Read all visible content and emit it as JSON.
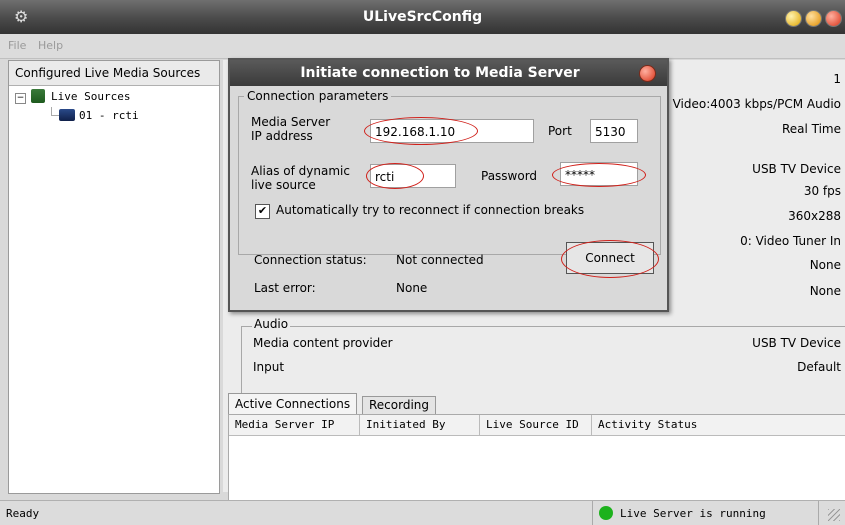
{
  "window": {
    "title": "ULiveSrcConfig"
  },
  "menu": [
    {
      "label": "File"
    },
    {
      "label": "Help"
    }
  ],
  "left_panel": {
    "header": "Configured Live Media Sources",
    "tree": {
      "root": "Live Sources",
      "child": "01 - rcti"
    }
  },
  "right_panel": {
    "values": [
      "1",
      "Video:4003 kbps/PCM Audio",
      "Real Time",
      "USB TV Device",
      "30 fps",
      "360x288",
      "0: Video Tuner In",
      "None",
      "None"
    ],
    "audio": {
      "title": "Audio",
      "rows": [
        {
          "label": "Media content provider",
          "value": "USB TV Device"
        },
        {
          "label": "Input",
          "value": "Default"
        }
      ]
    }
  },
  "tabs": [
    "Active Connections",
    "Recording"
  ],
  "table": {
    "columns": [
      "Media Server IP",
      "Initiated By",
      "Live Source ID",
      "Activity Status"
    ],
    "rows": []
  },
  "status_bar": {
    "left": "Ready",
    "right": "Live Server is running",
    "indicator_color": "#1db21d"
  },
  "dialog": {
    "title": "Initiate connection to Media Server",
    "group_title": "Connection parameters",
    "ip_label_1": "Media Server",
    "ip_label_2": "IP address",
    "ip_value": "192.168.1.10",
    "port_label": "Port",
    "port_value": "5130",
    "alias_label_1": "Alias of dynamic",
    "alias_label_2": "live source",
    "alias_value": "rcti",
    "password_label": "Password",
    "password_value": "*****",
    "auto_reconnect_label": "Automatically try to reconnect if connection breaks",
    "auto_reconnect_checked": true,
    "status_label": "Connection status:",
    "status_value": "Not connected",
    "error_label": "Last error:",
    "error_value": "None",
    "connect_label": "Connect",
    "highlight_color": "#d0201a"
  }
}
